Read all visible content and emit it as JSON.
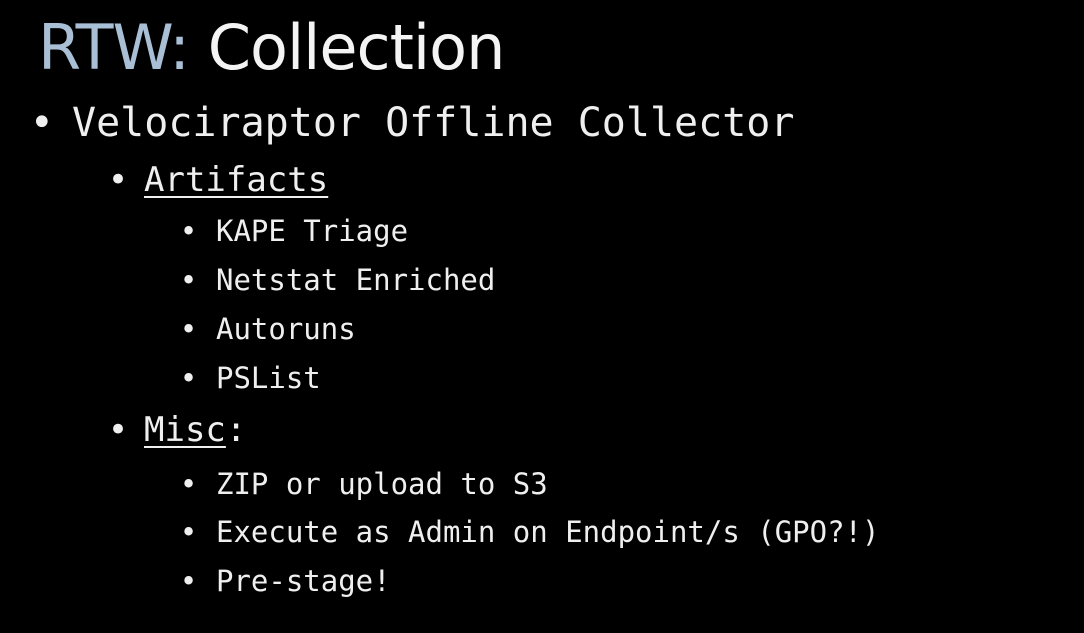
{
  "slide": {
    "title_prefix": "RTW:",
    "title_main": "Collection",
    "level1": {
      "text": "Velociraptor Offline Collector"
    },
    "artifacts": {
      "heading": "Artifacts",
      "items": [
        "KAPE Triage",
        "Netstat Enriched",
        "Autoruns",
        "PSList"
      ]
    },
    "misc": {
      "heading": "Misc",
      "suffix": ":",
      "items": [
        "ZIP or upload to S3",
        "Execute as Admin on Endpoint/s (GPO?!)",
        "Pre-stage!"
      ]
    },
    "bullet_glyph": "•"
  },
  "colors": {
    "background": "#000000",
    "title_prefix": "#a9bfd6",
    "text": "#f2f2f2"
  }
}
